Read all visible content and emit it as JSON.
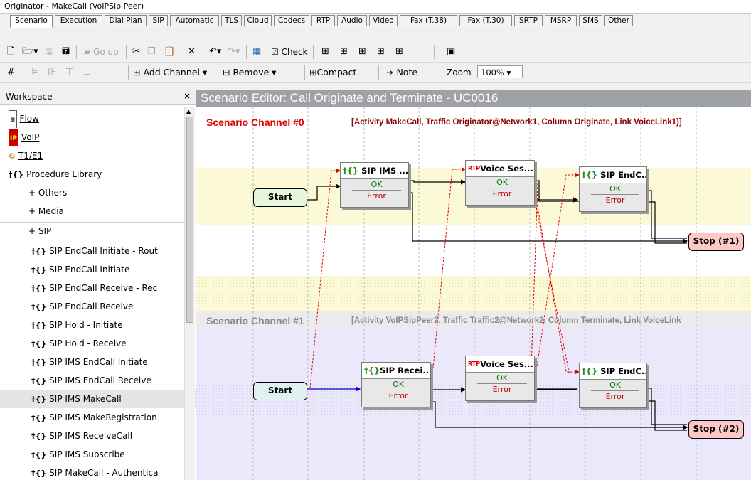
{
  "window": {
    "title": "Originator - MakeCall (VoIPSip Peer)"
  },
  "tabs": [
    "Scenario",
    "Execution",
    "Dial Plan",
    "SIP",
    "Automatic",
    "TLS",
    "Cloud",
    "Codecs",
    "RTP",
    "Audio",
    "Video",
    "Fax (T.38)",
    "Fax (T.30)",
    "SRTP",
    "MSRP",
    "SMS",
    "Other"
  ],
  "toolbar1": {
    "goup": "Go up",
    "check": "Check"
  },
  "toolbar2": {
    "add_channel": "Add Channel",
    "remove": "Remove",
    "compact": "Compact",
    "note": "Note",
    "zoom_label": "Zoom",
    "zoom_value": "100%"
  },
  "workspace": {
    "title": "Workspace",
    "close": "×",
    "items": [
      {
        "label": "Flow"
      },
      {
        "label": "VoIP"
      },
      {
        "label": "T1/E1"
      },
      {
        "label": "Procedure Library"
      },
      {
        "label": "+ Others"
      },
      {
        "label": "+ Media"
      },
      {
        "label": "+ SIP"
      },
      {
        "label": "SIP EndCall Initiate - Rout"
      },
      {
        "label": "SIP EndCall Initiate"
      },
      {
        "label": "SIP EndCall Receive - Rec"
      },
      {
        "label": "SIP EndCall Receive"
      },
      {
        "label": "SIP Hold - Initiate"
      },
      {
        "label": "SIP Hold - Receive"
      },
      {
        "label": "SIP IMS EndCall Initiate"
      },
      {
        "label": "SIP IMS EndCall Receive"
      },
      {
        "label": "SIP IMS MakeCall"
      },
      {
        "label": "SIP IMS MakeRegistration"
      },
      {
        "label": "SIP IMS ReceiveCall"
      },
      {
        "label": "SIP IMS Subscribe"
      },
      {
        "label": "SIP MakeCall - Authentica"
      }
    ]
  },
  "editor": {
    "title": "Scenario Editor: Call Originate and Terminate - UC0016",
    "channel0": {
      "label": "Scenario Channel #0",
      "info": "[Activity MakeCall, Traffic Originator@Network1, Column Originate, Link VoiceLink1)]"
    },
    "channel1": {
      "label": "Scenario Channel #1",
      "info": "[Activity VoIPSipPeer2, Traffic Traffic2@Network2, Column Terminate, Link VoiceLink"
    },
    "start_label": "Start",
    "ok_label": "OK",
    "error_label": "Error",
    "stop1": "Stop (#1)",
    "stop2": "Stop (#2)",
    "nodes": {
      "n1": "SIP IMS ...",
      "n2": "Voice Ses...",
      "n3": "SIP EndC...",
      "n4": "SIP Recei...",
      "n5": "Voice Ses...",
      "n6": "SIP EndC..."
    }
  },
  "colors": {
    "channel0_band": "#fbf9d6",
    "channel1_band": "#ebe8fb",
    "title_red": "#e00000",
    "info_red": "#8b0000",
    "start_green": "#e6f7dc",
    "start_teal": "#dff2f0",
    "stop_pink": "#ffc8c8"
  }
}
